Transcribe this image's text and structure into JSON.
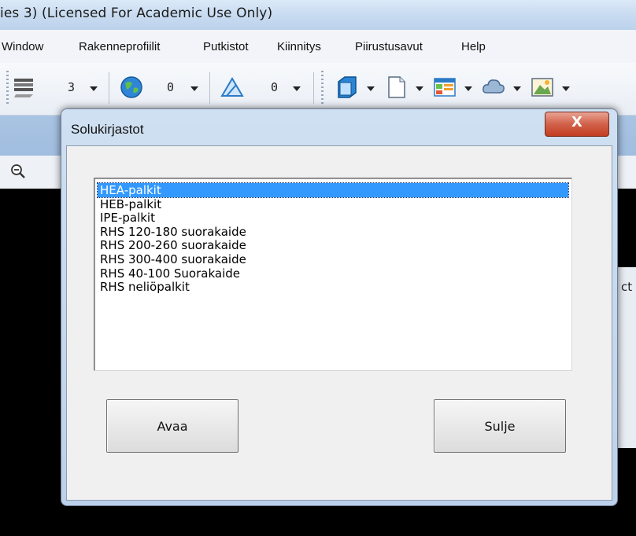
{
  "window": {
    "title": "ies 3) (Licensed For Academic Use Only)"
  },
  "menu": {
    "items": [
      "Window",
      "Rakenneprofiilit",
      "Putkistot",
      "Kiinnitys",
      "Piirustusavut",
      "Help"
    ]
  },
  "toolbar": {
    "layer_value": "3",
    "color_value": "0",
    "style_value": "0"
  },
  "side_panel": {
    "partial_text": "ct"
  },
  "dialog": {
    "title": "Solukirjastot",
    "close_label": "X",
    "list": {
      "selected_index": 0,
      "items": [
        "HEA-palkit",
        "HEB-palkit",
        "IPE-palkit",
        "RHS 120-180 suorakaide",
        "RHS 200-260 suorakaide",
        "RHS 300-400 suorakaide",
        "RHS 40-100 Suorakaide",
        "RHS neliöpalkit"
      ]
    },
    "buttons": {
      "open": "Avaa",
      "close": "Sulje"
    }
  },
  "colors": {
    "selection": "#3399ff",
    "close_button": "#c94a2f",
    "dialog_frame": "#bcd1ea"
  }
}
